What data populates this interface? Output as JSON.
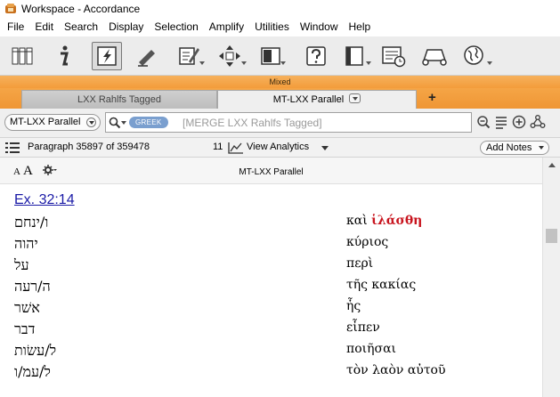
{
  "window": {
    "title": "Workspace - Accordance"
  },
  "menu": [
    "File",
    "Edit",
    "Search",
    "Display",
    "Selection",
    "Amplify",
    "Utilities",
    "Window",
    "Help"
  ],
  "toolbar": {
    "icons": [
      "library-icon",
      "info-icon",
      "highlight-search-icon",
      "pen-icon",
      "notes-icon",
      "move-icon",
      "panes-icon",
      "help-icon",
      "sidebar-icon",
      "timeline-icon",
      "atlas-icon",
      "globe-icon"
    ]
  },
  "zone_label": "Mixed",
  "tabs": [
    {
      "label": "LXX Rahlfs Tagged",
      "active": false
    },
    {
      "label": "MT-LXX Parallel",
      "active": true
    }
  ],
  "add_tab_label": "+",
  "search": {
    "module": "MT-LXX Parallel",
    "language_tag": "GREEK",
    "query": "[MERGE LXX Rahlfs Tagged]"
  },
  "status": {
    "paragraph": "Paragraph 35897 of 359478",
    "hits": "11",
    "analytics_label": "View Analytics",
    "add_notes_label": "Add Notes"
  },
  "pane": {
    "font_small": "A",
    "font_large": "A",
    "title": "MT-LXX Parallel"
  },
  "reference": "Ex. 32:14",
  "rows": [
    {
      "hebrew": "ו/ינחם",
      "greek": "καὶ",
      "greek_hl": "ἱλάσθη"
    },
    {
      "hebrew": "יהוה",
      "greek": "κύριος",
      "greek_hl": ""
    },
    {
      "hebrew": "על",
      "greek": "περὶ",
      "greek_hl": ""
    },
    {
      "hebrew": "ה/רעה",
      "greek": "τῆς κακίας",
      "greek_hl": ""
    },
    {
      "hebrew": "אשׁר",
      "greek": "ἧς",
      "greek_hl": ""
    },
    {
      "hebrew": "דבר",
      "greek": "εἶπεν",
      "greek_hl": ""
    },
    {
      "hebrew": "ל/עשׂות",
      "greek": "ποιῆσαι",
      "greek_hl": ""
    },
    {
      "hebrew": "ל/עמ/ו",
      "greek": "τὸν λαὸν αὐτοῦ",
      "greek_hl": ""
    }
  ],
  "colors": {
    "accent_orange": "#f39c3a",
    "link_blue": "#1a1aa6",
    "hit_red": "#c8141e",
    "greek_pill": "#7a9fcf"
  }
}
